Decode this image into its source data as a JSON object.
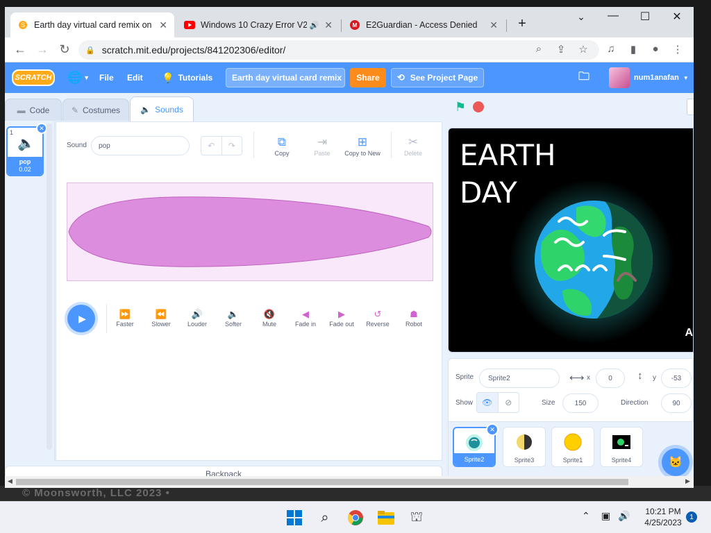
{
  "browser": {
    "tabs": [
      {
        "title": "Earth day virtual card remix on S",
        "active": true
      },
      {
        "title": "Windows 10 Crazy Error V2",
        "active": false
      },
      {
        "title": "E2Guardian - Access Denied",
        "active": false
      }
    ],
    "url": "scratch.mit.edu/projects/841202306/editor/"
  },
  "menubar": {
    "logo": "SCRATCH",
    "file": "File",
    "edit": "Edit",
    "tutorials": "Tutorials",
    "project_title": "Earth day virtual card remix",
    "share": "Share",
    "see_project": "See Project Page",
    "username": "num1anafan"
  },
  "editor_tabs": {
    "code": "Code",
    "costumes": "Costumes",
    "sounds": "Sounds"
  },
  "sound_list": {
    "items": [
      {
        "number": "1",
        "name": "pop",
        "duration": "0.02"
      }
    ]
  },
  "sound_editor": {
    "sound_label": "Sound",
    "sound_name": "pop",
    "tools": {
      "copy": "Copy",
      "paste": "Paste",
      "copy_to_new": "Copy to New",
      "delete": "Delete"
    },
    "effects": [
      "Faster",
      "Slower",
      "Louder",
      "Softer",
      "Mute",
      "Fade in",
      "Fade out",
      "Reverse",
      "Robot"
    ],
    "colors": {
      "waveform_fill": "#dd8ddd",
      "waveform_bg": "#f9e8f9"
    }
  },
  "backpack": "Backpack",
  "stage": {
    "title_line1": "EARTH",
    "title_line2": "DAY",
    "corner_text": "A"
  },
  "sprite_info": {
    "sprite_label": "Sprite",
    "sprite_name": "Sprite2",
    "x_label": "x",
    "x_value": "0",
    "y_label": "y",
    "y_value": "-53",
    "show_label": "Show",
    "size_label": "Size",
    "size_value": "150",
    "direction_label": "Direction",
    "direction_value": "90"
  },
  "sprites": [
    {
      "name": "Sprite2",
      "selected": true
    },
    {
      "name": "Sprite3",
      "selected": false
    },
    {
      "name": "Sprite1",
      "selected": false
    },
    {
      "name": "Sprite4",
      "selected": false
    }
  ],
  "desktop_footer": "© Moonsworth, LLC 2023 •",
  "taskbar": {
    "time": "10:21 PM",
    "date": "4/25/2023",
    "notifications": "1"
  }
}
